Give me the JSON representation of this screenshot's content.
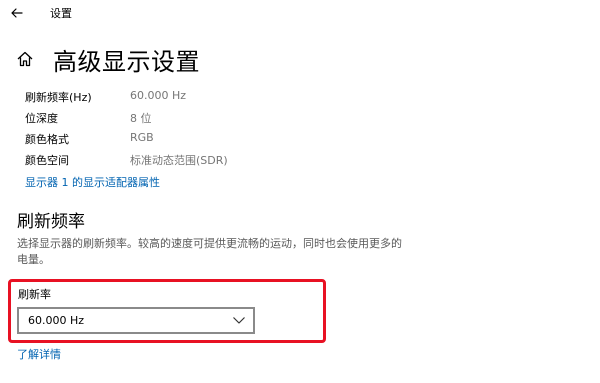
{
  "window": {
    "title": "设置"
  },
  "header": {
    "title": "高级显示设置"
  },
  "display_info": [
    {
      "label": "刷新频率(Hz)",
      "value": "60.000 Hz"
    },
    {
      "label": "位深度",
      "value": "8 位"
    },
    {
      "label": "颜色格式",
      "value": "RGB"
    },
    {
      "label": "颜色空间",
      "value": "标准动态范围(SDR)"
    }
  ],
  "adapter_link": "显示器 1 的显示适配器属性",
  "refresh_section": {
    "title": "刷新频率",
    "description": "选择显示器的刷新频率。较高的速度可提供更流畅的运动，同时也会使用更多的电量。",
    "dropdown_label": "刷新率",
    "dropdown_value": "60.000 Hz",
    "learn_more": "了解详情"
  },
  "colors": {
    "accent_link": "#0063b1",
    "highlight": "#e81123"
  },
  "icons": {
    "back": "arrow-left-icon",
    "home": "home-icon",
    "dropdown": "chevron-down-icon"
  }
}
